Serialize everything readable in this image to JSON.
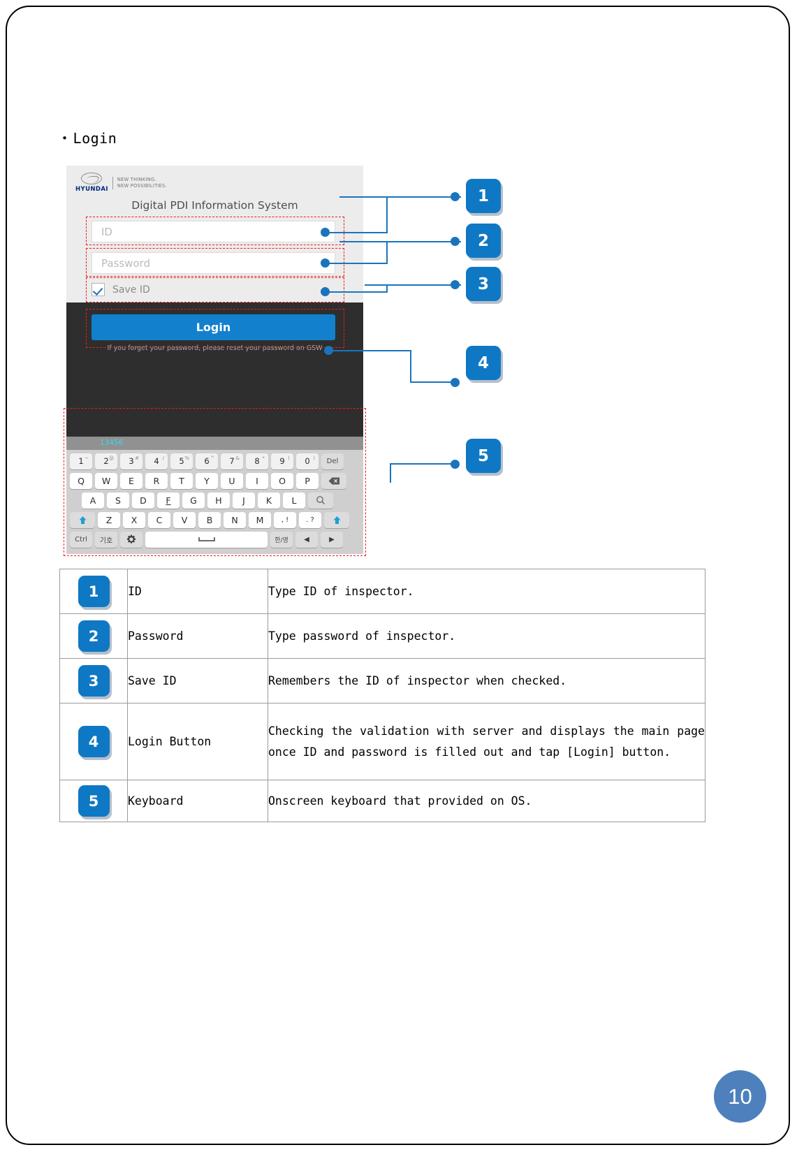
{
  "page": {
    "heading": "Login",
    "bullet_glyph": "•",
    "page_number": "10"
  },
  "device": {
    "logo": {
      "wordmark": "HYUNDAI",
      "tagline_line1": "NEW THINKING.",
      "tagline_line2": "NEW POSSIBILITIES."
    },
    "app_title": "Digital PDI Information System",
    "id_placeholder": "ID",
    "password_placeholder": "Password",
    "save_id_label": "Save ID",
    "login_label": "Login",
    "forgot_text": "If you forget your password, please reset your password on GSW",
    "keyboard": {
      "suggestion": "13456",
      "number_row": [
        {
          "label": "1",
          "sup": "~"
        },
        {
          "label": "2",
          "sup": "@"
        },
        {
          "label": "3",
          "sup": "#"
        },
        {
          "label": "4",
          "sup": "/"
        },
        {
          "label": "5",
          "sup": "%"
        },
        {
          "label": "6",
          "sup": "^"
        },
        {
          "label": "7",
          "sup": "&"
        },
        {
          "label": "8",
          "sup": "*"
        },
        {
          "label": "9",
          "sup": "("
        },
        {
          "label": "0",
          "sup": ")"
        }
      ],
      "delete_label": "Del",
      "row1": [
        "Q",
        "W",
        "E",
        "R",
        "T",
        "Y",
        "U",
        "I",
        "O",
        "P"
      ],
      "backspace_icon": "backspace-icon",
      "row2": [
        "A",
        "S",
        "D",
        "F",
        "G",
        "H",
        "J",
        "K",
        "L"
      ],
      "search_icon": "search-icon",
      "row3": [
        "Z",
        "X",
        "C",
        "V",
        "B",
        "N",
        "M"
      ],
      "comma_key": ", !",
      "period_key": ". ?",
      "shift_icon": "shift-arrow-icon",
      "ctrl_label": "Ctrl",
      "symbol_label": "기호",
      "gear_icon": "gear-icon",
      "space_icon": "space-bar-icon",
      "lang_label": "한/영",
      "arrow_left": "◀",
      "arrow_right": "▶"
    }
  },
  "callouts": [
    {
      "number": "1"
    },
    {
      "number": "2"
    },
    {
      "number": "3"
    },
    {
      "number": "4"
    },
    {
      "number": "5"
    }
  ],
  "table": {
    "rows": [
      {
        "number": "1",
        "name": "ID",
        "description": "Type ID of inspector."
      },
      {
        "number": "2",
        "name": "Password",
        "description": "Type password of inspector."
      },
      {
        "number": "3",
        "name": "Save ID",
        "description": "Remembers the ID of inspector when checked."
      },
      {
        "number": "4",
        "name": "Login Button",
        "description": "Checking the validation with server and displays the main page once ID and password is filled out and tap [Login] button."
      },
      {
        "number": "5",
        "name": "Keyboard",
        "description": "Onscreen keyboard that provided on OS."
      }
    ]
  },
  "colors": {
    "accent_blue": "#0f78c4",
    "login_blue": "#1380cd",
    "highlight_red": "#ef1c1c",
    "page_badge_blue": "#4e80bd",
    "suggestion_cyan": "#39d7ee"
  }
}
